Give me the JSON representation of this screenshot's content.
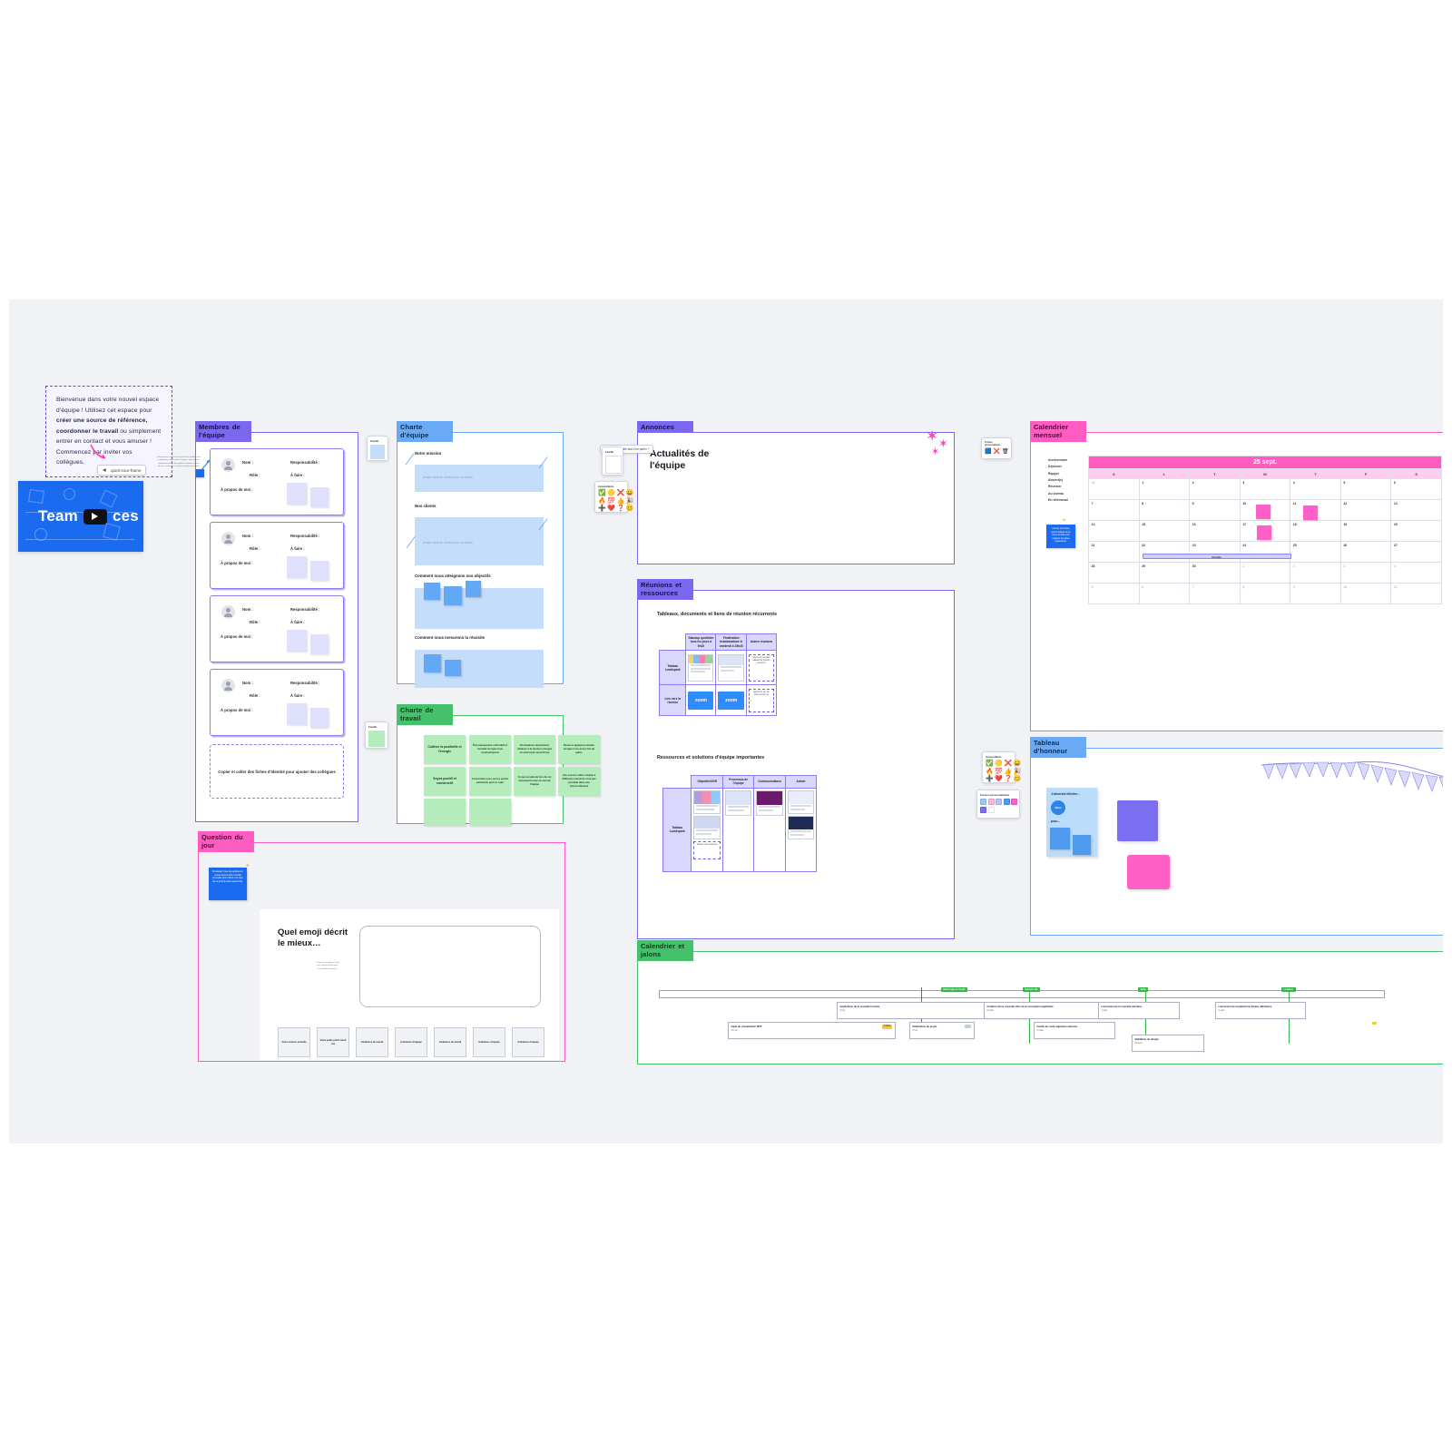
{
  "welcome": {
    "text_parts": [
      "Bienvenue dans votre nouvel espace d'équipe ! Utilisez cet espace pour ",
      "créer une source de référence, coordonner le travail",
      " ou simplement entrer en contact et vous amuser ! Commencez par inviter vos collègues."
    ],
    "pill_label": "quick-tour-frame"
  },
  "video_card": {
    "title": "Team Spaces",
    "play_icon": "play-icon"
  },
  "hints": {
    "members_hint": "Sélectionnez une fiche de profil et le modèle pour la dupliquer pour la mise à niveau. Vous pouvez également placer des photos et ajouter à partir de vos coéquipiers et de leur espace de travail.",
    "question_hint": "Choisissez l'une des activités ci-contre dans la barre d'outils principale pour obtenir une idée de ce qu'il faut faire aujourd'hui.",
    "calendar_hint": "Insérez une forme personnalisée de la barre d'outils pour marquer les dates importantes."
  },
  "frames": {
    "members": {
      "title": "Membres de l'équipe",
      "color": "#7b68ee"
    },
    "charter": {
      "title": "Charte d'équipe",
      "color": "#6aa9f4"
    },
    "work_charter": {
      "title": "Charte de travail",
      "color": "#46c16b"
    },
    "question": {
      "title": "Question du jour",
      "color": "#ff5bc0"
    },
    "announcements": {
      "title": "Annonces",
      "color": "#7b68ee"
    },
    "meetings": {
      "title": "Réunions et ressources",
      "color": "#7b68ee"
    },
    "calendar": {
      "title": "Calendrier mensuel",
      "color": "#ff5bc0"
    },
    "honor_board": {
      "title": "Tableau d'honneur",
      "color": "#6aa9f4"
    },
    "milestones": {
      "title": "Calendrier et jalons",
      "color": "#46c16b"
    }
  },
  "member_card": {
    "labels": {
      "name": "Nom :",
      "role": "Rôle :",
      "responsibility": "Responsabilité :",
      "todo": "À faire :",
      "about": "À propos de moi :"
    },
    "avatar_icon": "user-avatar-icon"
  },
  "members_footer": "Copier et coller des fiches d'identité pour ajouter des collègues",
  "charter": {
    "sections": [
      {
        "label": "Notre mission",
        "placeholder": "plugin default: écrire plus en détail"
      },
      {
        "label": "Nos clients",
        "placeholder": "plugin default: écrire plus en détail"
      },
      {
        "label": "Comment nous atteignons nos objectifs",
        "placeholder": ""
      },
      {
        "label": "Comment nous mesurons la réussite",
        "placeholder": ""
      }
    ]
  },
  "work_charter": {
    "notes": [
      "Cultiver la positivité et l'énergie",
      "Être transparent, informatif et honnête lorsque nous communiquons",
      "Informations importantes relatives à la réunion envoyée en amont par asynchrone",
      "Passer à quelqu'un d'autre lorsque nous avons fini de parler",
      "Soyez positif et constructif",
      "Concentrez-vous sur les points pertinents pour le sujet",
      "Ce qui est abordé lors de cet événement reste au sein de l'équipe",
      "Une session vidéo ouverte à différents moments n'est pas possible dans une visioconférence",
      "",
      ""
    ]
  },
  "announcements": {
    "heading": "Actualités de l'équipe",
    "pill_label": "quelle feuille faut-il en parler ?"
  },
  "meetings": {
    "table1_title": "Tableaux, documents et liens de réunion récurrents",
    "table1_cols": [
      "Standup quotidien tous les jours à 9h15",
      "Finalisation hebdomadaire le vendredi à 15h45",
      "Autres réunions"
    ],
    "table1_rows": [
      "Tableau Lucidspark",
      "Lien vers la réunion"
    ],
    "zoom_label": "zoom",
    "table2_title": "Ressources et solutions d'équipe importantes",
    "table2_cols": [
      "Objectifs/OKR",
      "Processus de l'équipe",
      "Communications",
      "Admin"
    ],
    "table2_rows": [
      "Tableau Lucidspark"
    ]
  },
  "calendar": {
    "month": "25 sept.",
    "dow": [
      "S",
      "L",
      "T",
      "W",
      "T",
      "F",
      "S"
    ],
    "weeks": [
      [
        {
          "d": "31",
          "out": true
        },
        {
          "d": "1"
        },
        {
          "d": "2"
        },
        {
          "d": "3"
        },
        {
          "d": "4"
        },
        {
          "d": "5"
        },
        {
          "d": "6"
        }
      ],
      [
        {
          "d": "7"
        },
        {
          "d": "8"
        },
        {
          "d": "9"
        },
        {
          "d": "10",
          "note": true
        },
        {
          "d": "11",
          "note": true
        },
        {
          "d": "12"
        },
        {
          "d": "13"
        }
      ],
      [
        {
          "d": "14"
        },
        {
          "d": "15"
        },
        {
          "d": "16"
        },
        {
          "d": "17",
          "note": true
        },
        {
          "d": "18"
        },
        {
          "d": "19"
        },
        {
          "d": "20"
        }
      ],
      [
        {
          "d": "21"
        },
        {
          "d": "22"
        },
        {
          "d": "23"
        },
        {
          "d": "24"
        },
        {
          "d": "25"
        },
        {
          "d": "26"
        },
        {
          "d": "27"
        }
      ],
      [
        {
          "d": "28"
        },
        {
          "d": "29"
        },
        {
          "d": "30"
        },
        {
          "d": "1",
          "out": true
        },
        {
          "d": "2",
          "out": true
        },
        {
          "d": "3",
          "out": true
        },
        {
          "d": "4",
          "out": true
        }
      ],
      [
        {
          "d": "5",
          "out": true
        },
        {
          "d": "6",
          "out": true
        },
        {
          "d": "7",
          "out": true
        },
        {
          "d": "8",
          "out": true
        },
        {
          "d": "9",
          "out": true
        },
        {
          "d": "10",
          "out": true
        },
        {
          "d": "11",
          "out": true
        }
      ]
    ],
    "event_label": "Retraite",
    "legend": [
      "Anniversaire",
      "Déjeuner",
      "Rappel",
      "Absent(e)",
      "Réunion",
      "Au bureau",
      "En télétravail"
    ]
  },
  "toolbox": {
    "reactions_label": "Autocollants",
    "reactions": [
      "✅",
      "🟡",
      "❌",
      "😀",
      "🔥",
      "💯",
      "👍",
      "🎉",
      "➕",
      "❤️",
      "❓",
      "😊"
    ],
    "shapes_label": "Formes personnalisées",
    "shape_colors": [
      "#9fc9f5",
      "#f9b6e0",
      "#b9c4fa",
      "#4f9bf0",
      "#ff60c8",
      "#7b6ef0",
      "#ffffff"
    ],
    "calendar_tool_label": "Formes personnalisées",
    "calendar_tool_icons": [
      "🟦",
      "❌",
      "🗑"
    ]
  },
  "honor_board": {
    "sticky_title": "J'aimerais féliciter...",
    "sticky_for": "pour...",
    "badge_label": "Merci"
  },
  "question": {
    "heading": "Quel emoji décrit le mieux…",
    "hint": "Créez un sondage à l'aide de la barre d'outils pour recueillir les réponses",
    "cards": [
      "Votre humeur actuelle",
      "Votre petite partie lundi soir",
      "Ambiance de travail",
      "Ambiance d'équipe",
      "Ambiance de travail",
      "Ambiance d'équipe",
      "Ambiance d'équipe"
    ]
  },
  "milestones": {
    "items": [
      {
        "title": "Application de la nouvelle formule",
        "date": "9 juin",
        "badge": "En cours",
        "badge_color": "#f5a623"
      },
      {
        "title": "Agile de visualisation MVP",
        "date": "11 mai",
        "badge": "À faire",
        "badge_color": "#f5c542"
      },
      {
        "title": "Création d'une nouvelle offre de la conception qualitative",
        "date": "8 juillet",
        "badge": "",
        "badge_color": "#c8ccd6"
      },
      {
        "title": "Lancement de la nouvelle interface",
        "date": "1 août",
        "badge": "",
        "badge_color": "#c8ccd6"
      },
      {
        "title": "Déclaration de projet",
        "date": "3 juin",
        "badge": "",
        "badge_color": "#c8ccd6"
      },
      {
        "title": "Feuille de route ingénierie achevée",
        "date": "5 juillet",
        "badge": "",
        "badge_color": "#c8ccd6"
      },
      {
        "title": "Lancement de la plateforme finales définitives",
        "date": "2 août",
        "badge": "",
        "badge_color": "#c8ccd6"
      },
      {
        "title": "Validation du design",
        "date": "20 août",
        "badge": "",
        "badge_color": "#c8ccd6"
      }
    ],
    "markers": [
      {
        "label": "Démarrage du travail",
        "color": "#35b44a"
      },
      {
        "label": "Révision Q3",
        "color": "#35b44a"
      },
      {
        "label": "Jalon",
        "color": "#35b44a"
      },
      {
        "label": "Livraison",
        "color": "#35b44a"
      }
    ]
  }
}
